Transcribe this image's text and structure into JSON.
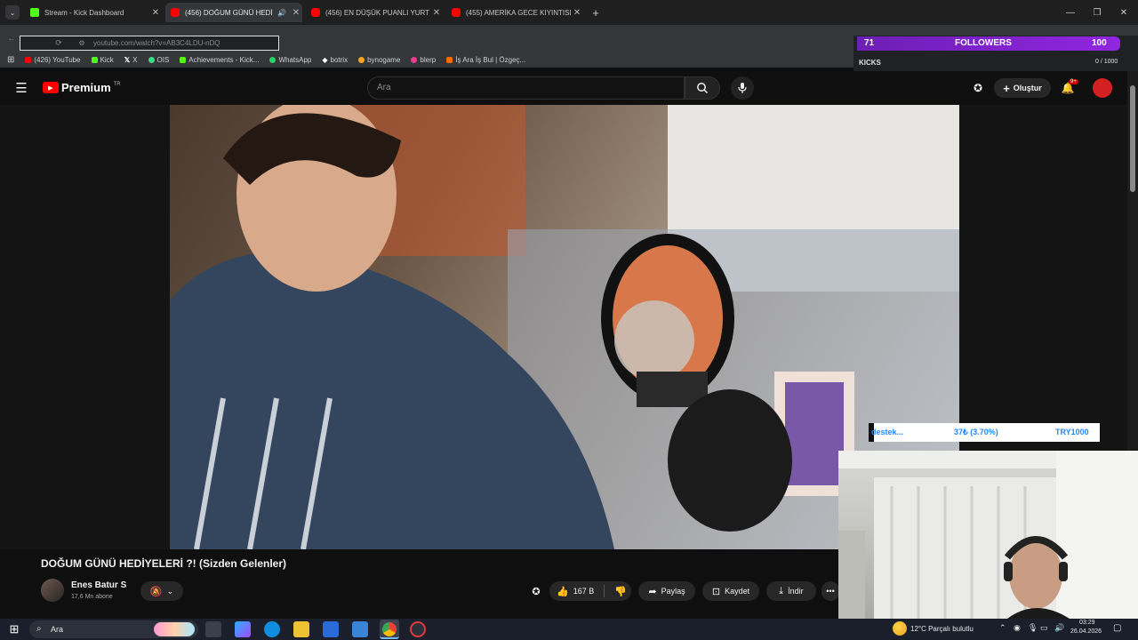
{
  "browser": {
    "tabs": [
      {
        "title": "Stream - Kick Dashboard",
        "favicon": "kick-icon",
        "active": false
      },
      {
        "title": "(456) DOĞUM GÜNÜ HEDİ",
        "favicon": "youtube-icon",
        "active": true
      },
      {
        "title": "(456) EN DÜŞÜK PUANLI YURT",
        "favicon": "youtube-icon",
        "active": false
      },
      {
        "title": "(455) AMERİKA GECE KIYINTISI",
        "favicon": "youtube-icon",
        "active": false
      }
    ],
    "new_tab_label": "+",
    "url": "youtube.com/watch?v=AB3C4LDU-nDQ",
    "bookmarks": [
      {
        "label": "(426) YouTube",
        "color": "#ff0000"
      },
      {
        "label": "Kick",
        "color": "#53fc18"
      },
      {
        "label": "X",
        "color": "#ffffff"
      },
      {
        "label": "OIS",
        "color": "#3ddc84"
      },
      {
        "label": "Achievements - Kick...",
        "color": "#53fc18"
      },
      {
        "label": "WhatsApp",
        "color": "#25d366"
      },
      {
        "label": "botrix",
        "color": "#ffffff"
      },
      {
        "label": "bynogame",
        "color": "#f5a623"
      },
      {
        "label": "blerp",
        "color": "#e83e8c"
      },
      {
        "label": "İş Ara İş Bul | Özgeç...",
        "color": "#ff6b00"
      }
    ]
  },
  "stream_overlay": {
    "followers_count": "71",
    "followers_label": "FOLLOWERS",
    "followers_goal": "100",
    "kicks_label": "KICKS",
    "kicks_progress": "0 / 1000",
    "donation_left": "destek...",
    "donation_mid": "37₺ (3.70%)",
    "donation_right": "TRY1000"
  },
  "youtube": {
    "logo_text": "Premium",
    "logo_region": "TR",
    "search_placeholder": "Ara",
    "create_label": "Oluştur",
    "notification_badge": "9+",
    "video_title": "DOĞUM GÜNÜ HEDİYELERİ ?! (Sizden Gelenler)",
    "channel_name": "Enes Batur S",
    "subscribers": "17,6 Mn abone",
    "like_count": "167 B",
    "share_label": "Paylaş",
    "save_label": "Kaydet",
    "download_label": "İndir"
  },
  "taskbar": {
    "search_label": "Ara",
    "weather": "12°C  Parçalı bulutlu",
    "time": "03:29",
    "date": "26.04.2026"
  },
  "colors": {
    "youtube_red": "#ff0000",
    "kick_green": "#53fc18",
    "overlay_purple": "#9126e0",
    "donation_blue": "#1e88ff"
  }
}
